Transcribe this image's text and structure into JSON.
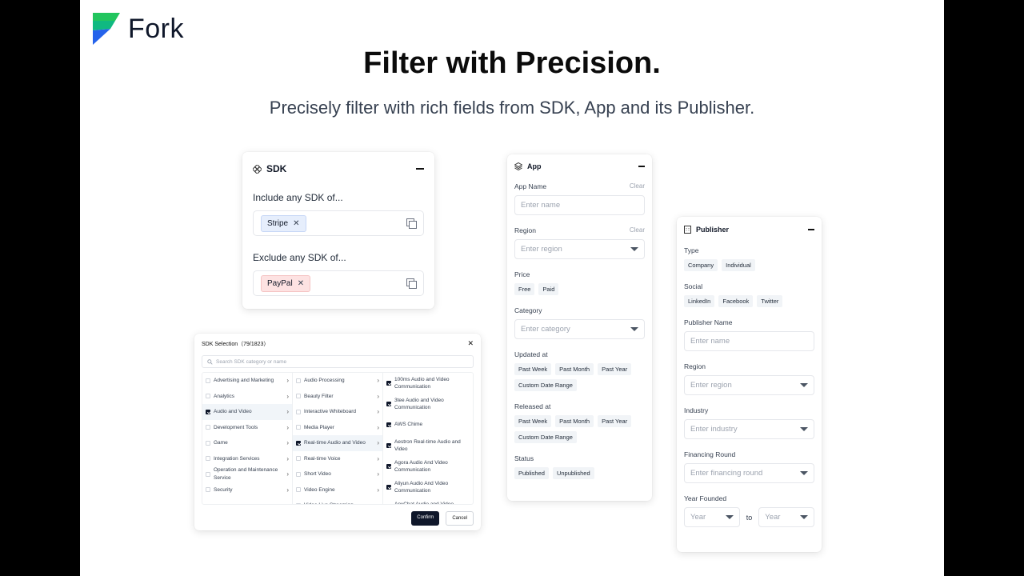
{
  "brand": {
    "name": "Fork"
  },
  "headline": "Filter with Precision.",
  "subline": "Precisely filter with rich fields from SDK, App and its Publisher.",
  "sdk_card": {
    "title": "SDK",
    "include_label": "Include any SDK of...",
    "include_chip": "Stripe",
    "exclude_label": "Exclude any SDK of...",
    "exclude_chip": "PayPal"
  },
  "sdk_modal": {
    "title": "SDK Selection（79/1823）",
    "search_placeholder": "Search SDK category or name",
    "col1": [
      "Advertising and Marketing",
      "Analytics",
      "Audio and Video",
      "Development Tools",
      "Game",
      "Integration Services",
      "Operation and Maintenance Service",
      "Security"
    ],
    "col2": [
      "Audio Processing",
      "Beauty Filter",
      "Interactive Whiteboard",
      "Media Player",
      "Real-time Audio and Video",
      "Real-time Voice",
      "Short Video",
      "Video Engine",
      "Video Live Streaming"
    ],
    "col3": [
      "100ms Audio and Video Communication",
      "3tee Audio and Video Communication",
      "AWS Chime",
      "Aestron Real-time Audio and Video",
      "Agora Audio And Video Communication",
      "Aliyun Audio And Video Communication",
      "AnyChat Audio and Video Communication"
    ],
    "confirm": "Confirm",
    "cancel": "Cancel"
  },
  "app_card": {
    "title": "App",
    "app_name_label": "App Name",
    "clear": "Clear",
    "app_name_placeholder": "Enter name",
    "region_label": "Region",
    "region_placeholder": "Enter region",
    "price_label": "Price",
    "price_tags": [
      "Free",
      "Paid"
    ],
    "category_label": "Category",
    "category_placeholder": "Enter category",
    "updated_label": "Updated at",
    "date_tags": [
      "Past Week",
      "Past Month",
      "Past Year",
      "Custom Date Range"
    ],
    "released_label": "Released at",
    "status_label": "Status",
    "status_tags": [
      "Published",
      "Unpublished"
    ]
  },
  "publisher_card": {
    "title": "Publisher",
    "type_label": "Type",
    "type_tags": [
      "Company",
      "Individual"
    ],
    "social_label": "Social",
    "social_tags": [
      "LinkedIn",
      "Facebook",
      "Twitter"
    ],
    "name_label": "Publisher Name",
    "name_placeholder": "Enter name",
    "region_label": "Region",
    "region_placeholder": "Enter region",
    "industry_label": "Industry",
    "industry_placeholder": "Enter industry",
    "financing_label": "Financing Round",
    "financing_placeholder": "Enter financing round",
    "year_label": "Year Founded",
    "year_placeholder": "Year",
    "to": "to"
  }
}
